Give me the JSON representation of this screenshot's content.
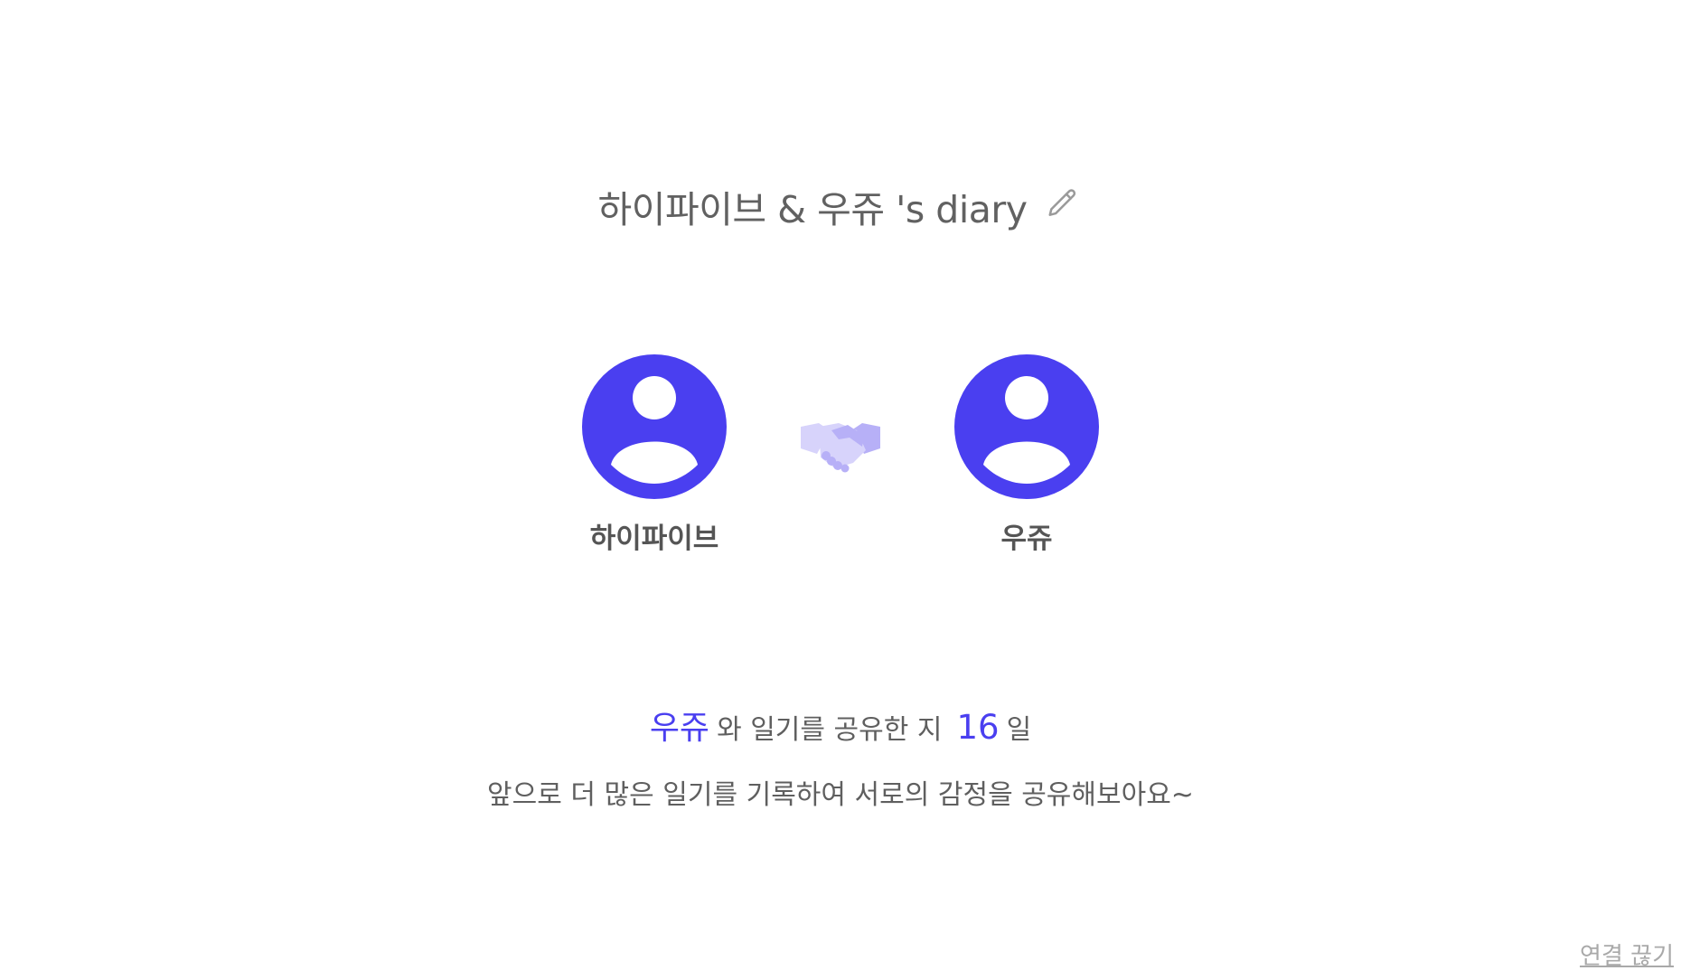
{
  "header": {
    "title": "하이파이브 & 우쥬 's diary",
    "edit_icon": "pencil-icon"
  },
  "members": [
    {
      "name": "하이파이브",
      "avatar_icon": "user-avatar-icon"
    },
    {
      "name": "우쥬",
      "avatar_icon": "user-avatar-icon"
    }
  ],
  "connection_icon": "handshake-icon",
  "share_info": {
    "partner_name": "우쥬",
    "text": "와 일기를 공유한 지",
    "days": "16",
    "unit": "일"
  },
  "encouragement": "앞으로 더 많은 일기를 기록하여 서로의 감정을 공유해보아요~",
  "disconnect_label": "연결 끊기",
  "colors": {
    "accent": "#4a3ff0",
    "text": "#5f5f5f",
    "muted": "#a9a9a9",
    "handshake_light": "#d7d3fb",
    "handshake_mid": "#b7b0f7"
  }
}
